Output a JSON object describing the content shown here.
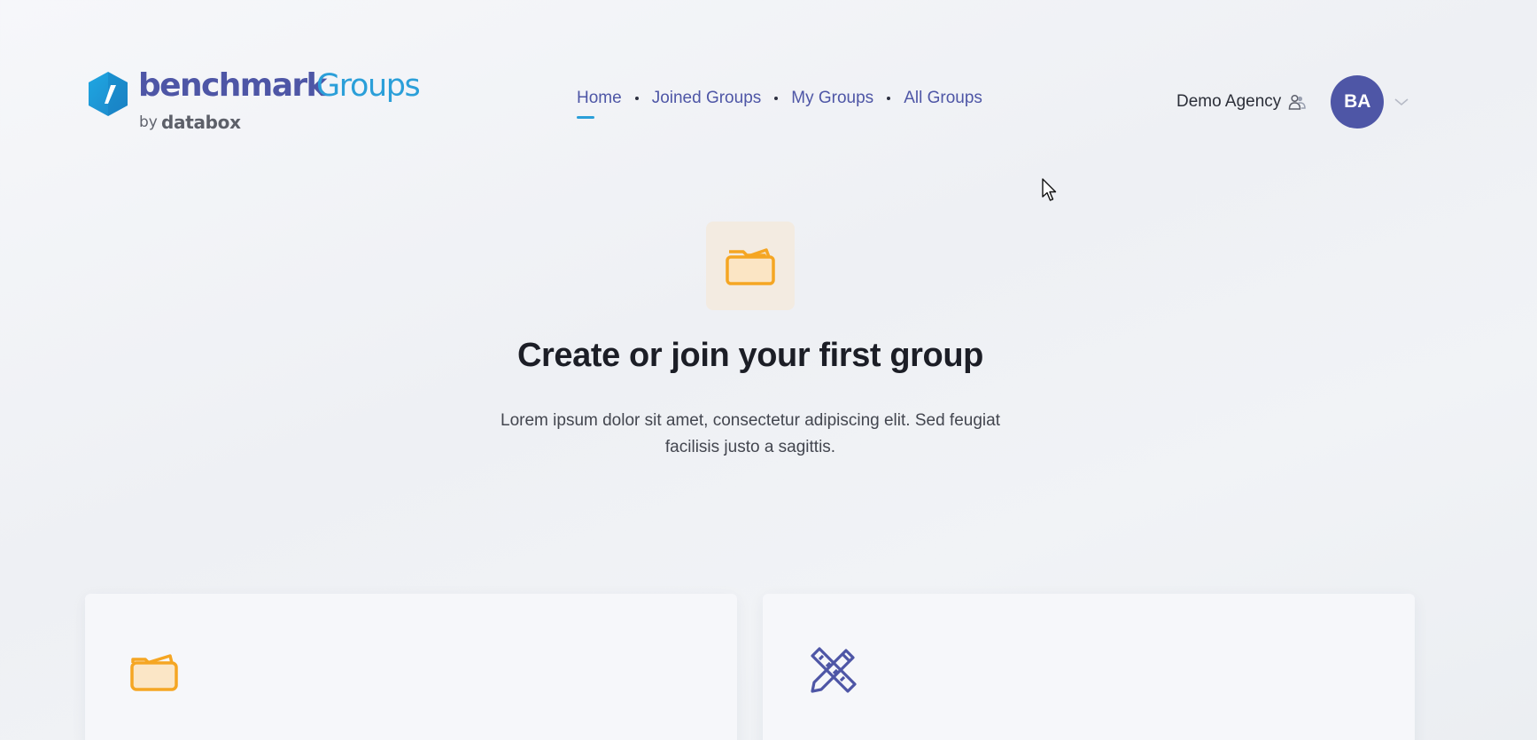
{
  "brand": {
    "name_primary": "benchmark",
    "name_secondary": "Groups",
    "by": "by",
    "company": "databox"
  },
  "nav": {
    "items": [
      {
        "label": "Home",
        "active": true
      },
      {
        "label": "Joined Groups",
        "active": false
      },
      {
        "label": "My Groups",
        "active": false
      },
      {
        "label": "All Groups",
        "active": false
      }
    ]
  },
  "account": {
    "agency_name": "Demo Agency",
    "avatar_initials": "BA"
  },
  "hero": {
    "icon": "folder-icon",
    "title": "Create or join your first group",
    "description": "Lorem ipsum dolor sit amet, consectetur adipiscing elit. Sed feugiat facilisis justo a sagittis."
  },
  "cards": [
    {
      "icon": "folder-icon"
    },
    {
      "icon": "pencil-ruler-icon"
    }
  ],
  "colors": {
    "brand_indigo": "#4e56a6",
    "brand_blue": "#2b9fd9",
    "folder_orange": "#f5a623",
    "hero_icon_bg": "#f3ebe1"
  }
}
